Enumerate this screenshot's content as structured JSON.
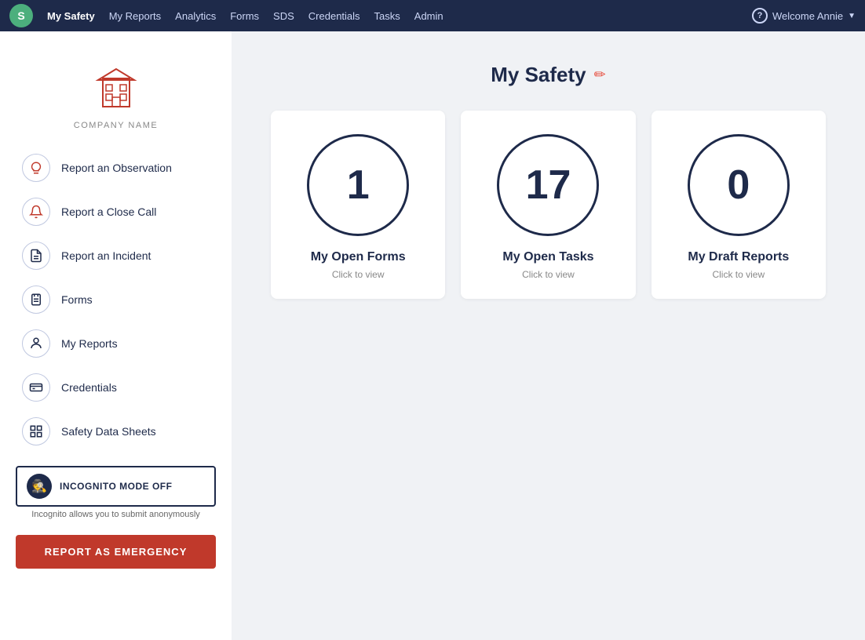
{
  "topnav": {
    "logo_letter": "S",
    "links": [
      {
        "label": "My Safety",
        "active": true,
        "name": "my-safety-link"
      },
      {
        "label": "My Reports",
        "active": false,
        "name": "my-reports-link"
      },
      {
        "label": "Analytics",
        "active": false,
        "name": "analytics-link"
      },
      {
        "label": "Forms",
        "active": false,
        "name": "forms-link"
      },
      {
        "label": "SDS",
        "active": false,
        "name": "sds-link"
      },
      {
        "label": "Credentials",
        "active": false,
        "name": "credentials-link"
      },
      {
        "label": "Tasks",
        "active": false,
        "name": "tasks-link"
      },
      {
        "label": "Admin",
        "active": false,
        "name": "admin-link"
      }
    ],
    "user_greeting": "Welcome Annie",
    "help_symbol": "?"
  },
  "sidebar": {
    "company_name": "COMPANY NAME",
    "nav_items": [
      {
        "label": "Report an Observation",
        "icon": "lightbulb",
        "name": "report-observation-item"
      },
      {
        "label": "Report a Close Call",
        "icon": "bell",
        "name": "report-close-call-item"
      },
      {
        "label": "Report an Incident",
        "icon": "document",
        "name": "report-incident-item"
      },
      {
        "label": "Forms",
        "icon": "clipboard",
        "name": "forms-item"
      },
      {
        "label": "My Reports",
        "icon": "person",
        "name": "my-reports-item"
      },
      {
        "label": "Credentials",
        "icon": "card",
        "name": "credentials-item"
      },
      {
        "label": "Safety Data Sheets",
        "icon": "grid",
        "name": "safety-data-sheets-item"
      }
    ],
    "incognito_label": "INCOGNITO MODE OFF",
    "incognito_desc": "Incognito allows you to submit anonymously",
    "emergency_label": "REPORT AS EMERGENCY"
  },
  "main": {
    "title": "My Safety",
    "edit_icon": "✏",
    "cards": [
      {
        "number": "1",
        "label": "My Open Forms",
        "sublabel": "Click to view",
        "name": "open-forms-card"
      },
      {
        "number": "17",
        "label": "My Open Tasks",
        "sublabel": "Click to view",
        "name": "open-tasks-card"
      },
      {
        "number": "0",
        "label": "My Draft Reports",
        "sublabel": "Click to view",
        "name": "draft-reports-card"
      }
    ]
  }
}
